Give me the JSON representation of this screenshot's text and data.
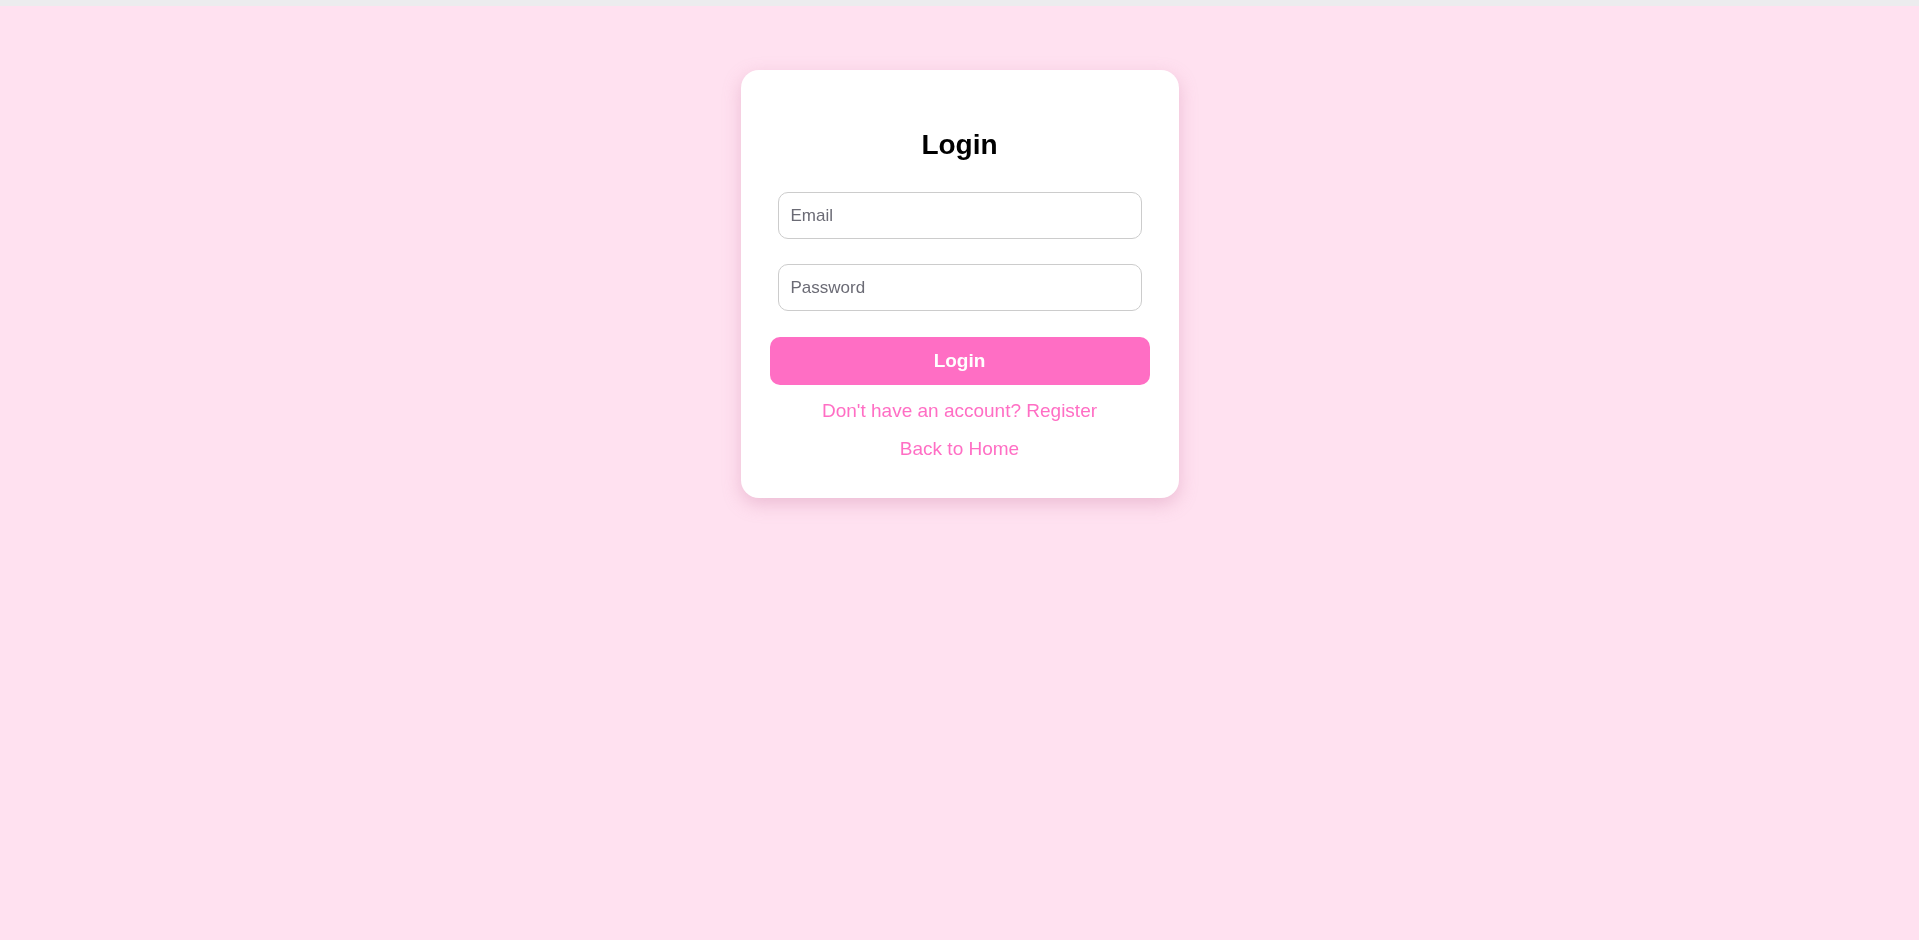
{
  "title": "Login",
  "fields": [
    {
      "placeholder": "Email"
    },
    {
      "placeholder": "Password"
    }
  ],
  "submit": "Login",
  "links": [
    "Don't have an account? Register",
    "Back to Home"
  ]
}
